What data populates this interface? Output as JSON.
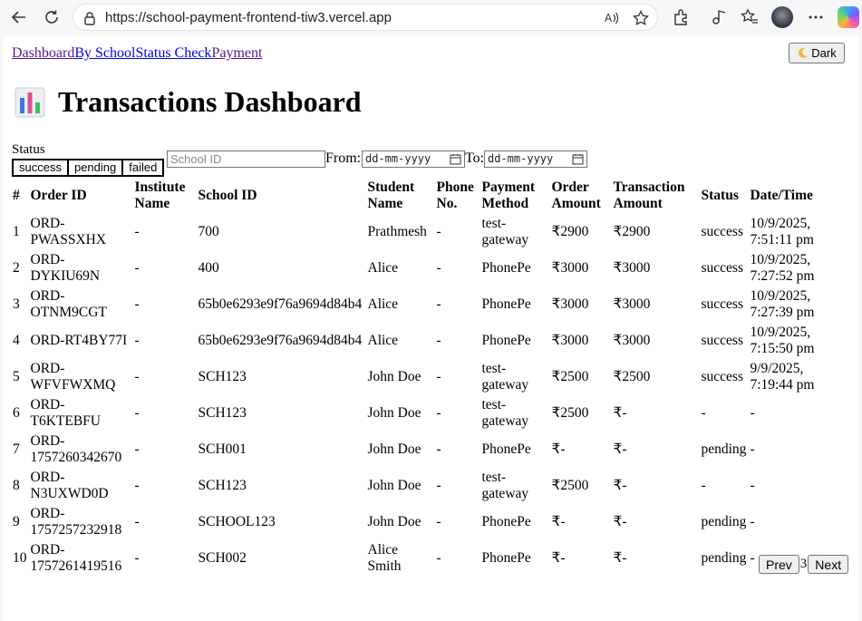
{
  "browser": {
    "url": "https://school-payment-frontend-tiw3.vercel.app"
  },
  "nav": {
    "links": [
      "Dashboard",
      "By School",
      "Status Check",
      "Payment"
    ]
  },
  "theme_toggle": {
    "icon": "moon-icon",
    "label": "Dark"
  },
  "page_title": "Transactions Dashboard",
  "filters": {
    "status_label": "Status",
    "status_options": [
      "success",
      "pending",
      "failed"
    ],
    "school_id_placeholder": "School ID",
    "from_label": "From:",
    "to_label": "To:",
    "date_placeholder": "dd-mm-yyyy"
  },
  "table": {
    "headers": [
      "#",
      "Order ID",
      "Institute Name",
      "School ID",
      "Student Name",
      "Phone No.",
      "Payment Method",
      "Order Amount",
      "Transaction Amount",
      "Status",
      "Date/Time"
    ],
    "rows": [
      [
        "1",
        "ORD-PWASSXHX",
        "-",
        "700",
        "Prathmesh",
        "-",
        "test-gateway",
        "₹2900",
        "₹2900",
        "success",
        "10/9/2025, 7:51:11 pm"
      ],
      [
        "2",
        "ORD-DYKIU69N",
        "-",
        "400",
        "Alice",
        "-",
        "PhonePe",
        "₹3000",
        "₹3000",
        "success",
        "10/9/2025, 7:27:52 pm"
      ],
      [
        "3",
        "ORD-OTNM9CGT",
        "-",
        "65b0e6293e9f76a9694d84b4",
        "Alice",
        "-",
        "PhonePe",
        "₹3000",
        "₹3000",
        "success",
        "10/9/2025, 7:27:39 pm"
      ],
      [
        "4",
        "ORD-RT4BY77I",
        "-",
        "65b0e6293e9f76a9694d84b4",
        "Alice",
        "-",
        "PhonePe",
        "₹3000",
        "₹3000",
        "success",
        "10/9/2025, 7:15:50 pm"
      ],
      [
        "5",
        "ORD-WFVFWXMQ",
        "-",
        "SCH123",
        "John Doe",
        "-",
        "test-gateway",
        "₹2500",
        "₹2500",
        "success",
        "9/9/2025, 7:19:44 pm"
      ],
      [
        "6",
        "ORD-T6KTEBFU",
        "-",
        "SCH123",
        "John Doe",
        "-",
        "test-gateway",
        "₹2500",
        "₹-",
        "-",
        "-"
      ],
      [
        "7",
        "ORD-1757260342670",
        "-",
        "SCH001",
        "John Doe",
        "-",
        "PhonePe",
        "₹-",
        "₹-",
        "pending",
        "-"
      ],
      [
        "8",
        "ORD-N3UXWD0D",
        "-",
        "SCH123",
        "John Doe",
        "-",
        "test-gateway",
        "₹2500",
        "₹-",
        "-",
        "-"
      ],
      [
        "9",
        "ORD-1757257232918",
        "-",
        "SCHOOL123",
        "John Doe",
        "-",
        "PhonePe",
        "₹-",
        "₹-",
        "pending",
        "-"
      ],
      [
        "10",
        "ORD-1757261419516",
        "-",
        "SCH002",
        "Alice Smith",
        "-",
        "PhonePe",
        "₹-",
        "₹-",
        "pending",
        "-"
      ]
    ]
  },
  "pagination": {
    "prev_label": "Prev",
    "page": "3",
    "next_label": "Next"
  }
}
